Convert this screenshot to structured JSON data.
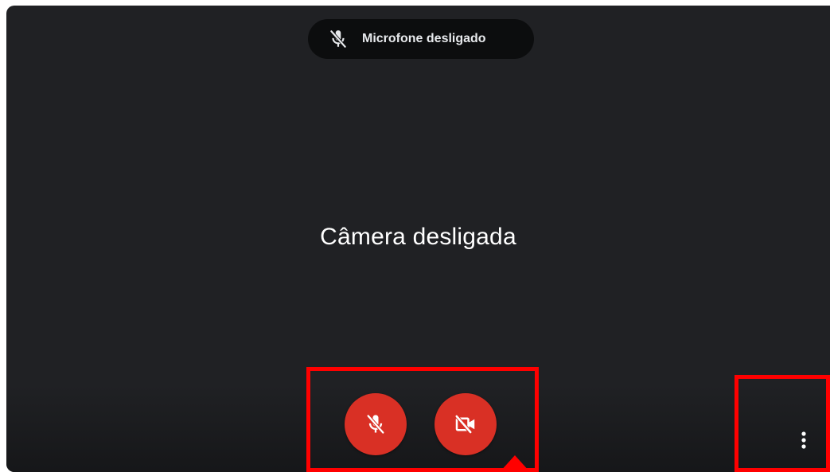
{
  "preview": {
    "mic_status_label": "Microfone desligado",
    "camera_status_text": "Câmera desligada"
  },
  "controls": {
    "mic_button_icon": "mic-off-icon",
    "camera_button_icon": "camera-off-icon",
    "more_options_icon": "more-vert-icon"
  },
  "colors": {
    "background": "#202124",
    "chip_background": "#0c0d0e",
    "button_red": "#d93025",
    "annotation_red": "#ff0000",
    "text_light": "#e8eaed"
  }
}
